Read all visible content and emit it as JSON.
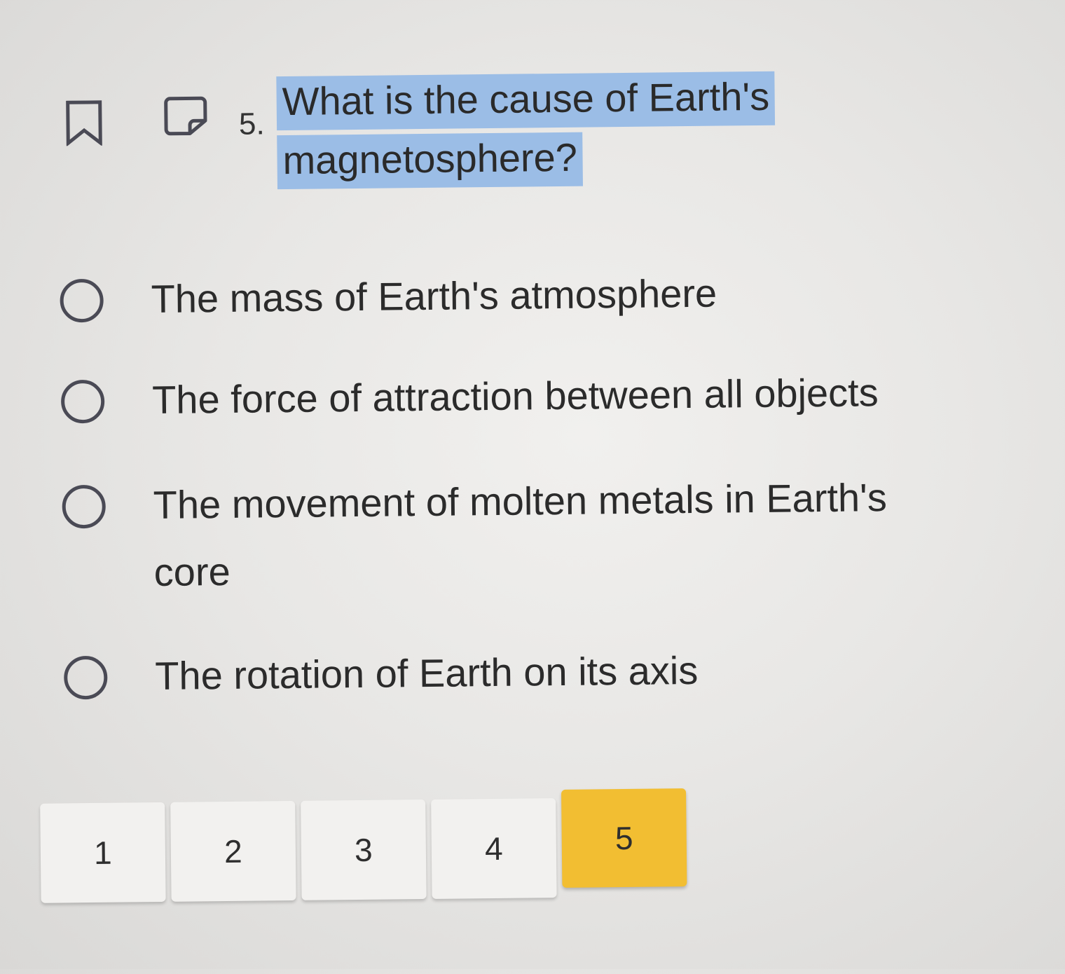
{
  "question": {
    "number": "5.",
    "line1": "What is the cause of Earth's",
    "line2": "magnetosphere?",
    "bookmark_icon": "bookmark-icon",
    "note_icon": "note-icon",
    "highlight_color": "#9bbde6"
  },
  "options": [
    {
      "label": "The mass of Earth's atmosphere"
    },
    {
      "label": "The force of attraction between all objects"
    },
    {
      "label": "The movement of molten metals in Earth's core"
    },
    {
      "label": "The rotation of Earth on its axis"
    }
  ],
  "pagination": {
    "pages": [
      "1",
      "2",
      "3",
      "4",
      "5"
    ],
    "current": "5",
    "active_color": "#f2be32"
  }
}
